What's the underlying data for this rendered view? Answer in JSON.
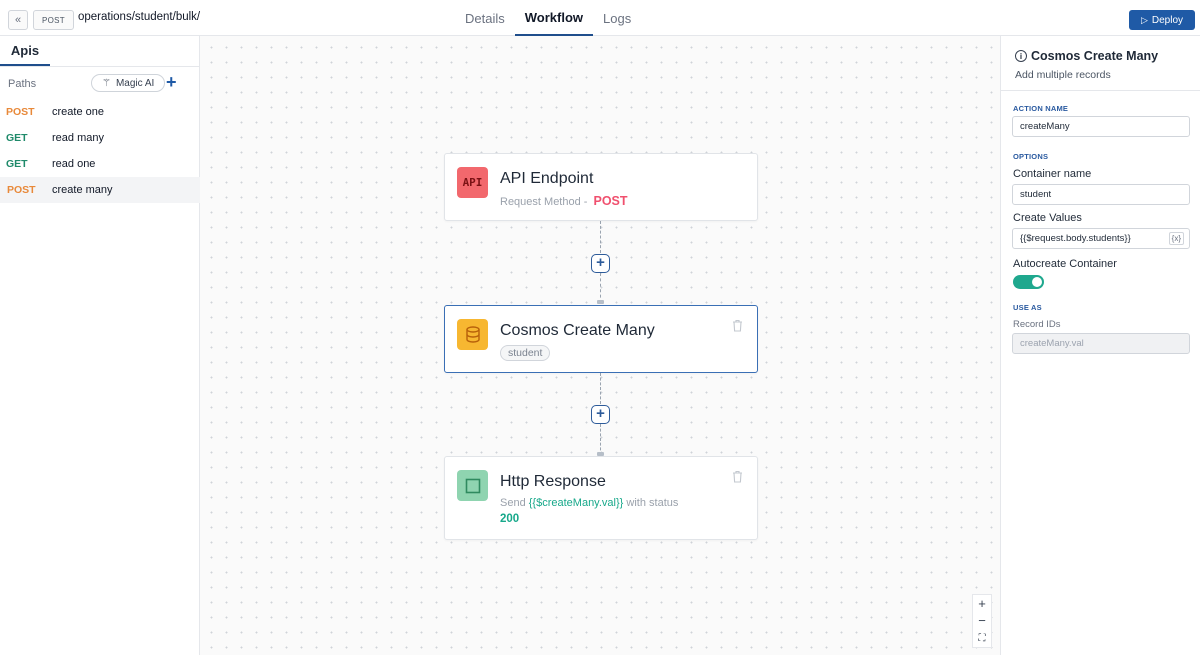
{
  "topbar": {
    "collapse_icon": "chevrons-left-icon",
    "collapse_glyph": "«",
    "method": "POST",
    "path": "operations/student/bulk/",
    "tabs": [
      {
        "label": "Details"
      },
      {
        "label": "Workflow"
      },
      {
        "label": "Logs"
      }
    ],
    "active_tab": "Workflow",
    "deploy_label": "Deploy",
    "deploy_glyph": "▷",
    "deploy_color": "#1f5aa6"
  },
  "sidebar": {
    "tab_label": "Apis",
    "paths_label": "Paths",
    "magic_label": "Magic AI",
    "magic_glyph": "⚚",
    "add_glyph": "+",
    "routes": [
      {
        "method": "POST",
        "name": "create one"
      },
      {
        "method": "GET",
        "name": "read many"
      },
      {
        "method": "GET",
        "name": "read one"
      },
      {
        "method": "POST",
        "name": "create many"
      }
    ],
    "selected_route": "create many"
  },
  "canvas": {
    "nodes": {
      "api": {
        "title": "API Endpoint",
        "icon_text": "API",
        "sub_prefix": "Request Method - ",
        "method": "POST"
      },
      "cosmos": {
        "title": "Cosmos Create Many",
        "tag": "student"
      },
      "response": {
        "title": "Http Response",
        "sub_prefix": "Send ",
        "value": "{{$createMany.val}}",
        "sub_suffix": " with status",
        "status": "200"
      }
    },
    "add_glyph": "+",
    "zoom": {
      "in": "+",
      "out": "−",
      "fit": "⛶"
    }
  },
  "panel": {
    "title": "Cosmos Create Many",
    "info_glyph": "i",
    "subtitle": "Add multiple records",
    "action_name_label": "ACTION NAME",
    "action_name_value": "createMany",
    "options_label": "OPTIONS",
    "container_label": "Container name",
    "container_value": "student",
    "create_values_label": "Create Values",
    "create_values_value": "{{$request.body.students}}",
    "create_values_icon": "{x}",
    "autocreate_label": "Autocreate Container",
    "autocreate_on": true,
    "use_as_label": "USE AS",
    "record_ids_label": "Record IDs",
    "record_ids_value": "createMany.val"
  },
  "colors": {
    "accent": "#1f5aa6",
    "post": "#e8893a",
    "get": "#1f8a6a",
    "toggle_on": "#1fa88e"
  }
}
